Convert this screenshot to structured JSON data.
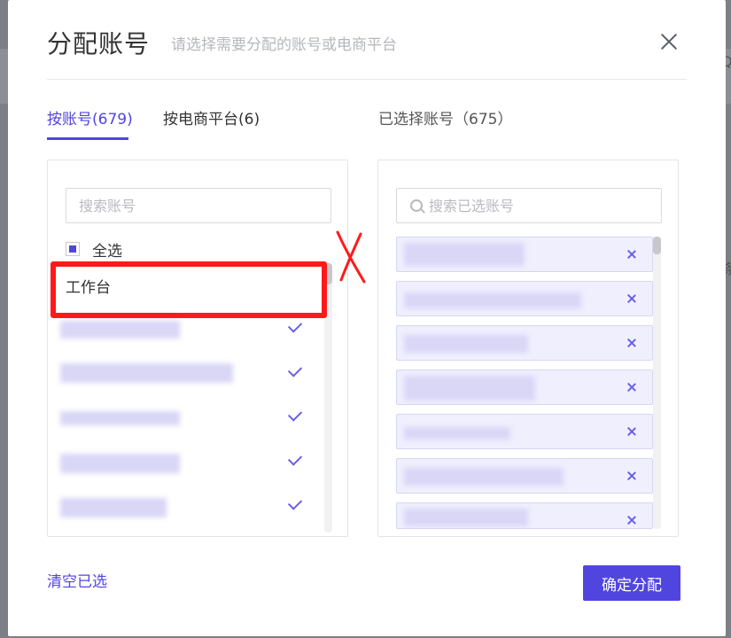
{
  "backdrop": {
    "glyphs": [
      "Q",
      "条"
    ]
  },
  "modal": {
    "title": "分配账号",
    "subtitle": "请选择需要分配的账号或电商平台",
    "close_icon": "close-icon"
  },
  "tabs": [
    {
      "label": "按账号(679)",
      "active": true
    },
    {
      "label": "按电商平台(6)",
      "active": false
    }
  ],
  "left_panel": {
    "search_placeholder": "搜索账号",
    "select_all_label": "全选",
    "select_all_state": "indeterminate",
    "items": [
      {
        "label": "工作台",
        "checked": false
      },
      {
        "label": "",
        "checked": true
      },
      {
        "label": "",
        "checked": true
      },
      {
        "label": "",
        "checked": true
      },
      {
        "label": "",
        "checked": true
      },
      {
        "label": "",
        "checked": true
      }
    ]
  },
  "right_panel": {
    "title": "已选择账号（675）",
    "search_placeholder": "搜索已选账号",
    "selected_count_visible": 7
  },
  "footer": {
    "clear_label": "清空已选",
    "confirm_label": "确定分配"
  },
  "annotations": {
    "highlight_color": "#ff1a1a",
    "mark": "X"
  },
  "colors": {
    "accent": "#5145e0",
    "selected_row_bg": "#f0effe"
  }
}
